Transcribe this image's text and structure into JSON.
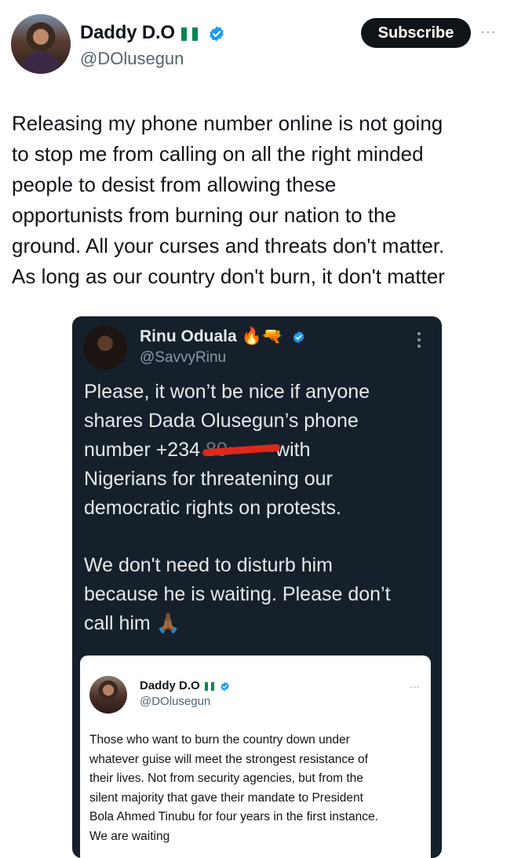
{
  "post": {
    "author_name": "Daddy D.O",
    "author_handle": "@DOlusegun",
    "subscribe_label": "Subscribe",
    "more_label": "···",
    "text_lines": [
      "Releasing my phone number online is not going",
      "to stop me from calling on all the right minded",
      "people to desist from allowing these",
      "opportunists from burning our nation to the",
      "ground. All your curses and threats don't matter.",
      "As long as our country don't burn, it don't matter"
    ]
  },
  "screenshot": {
    "author_name": "Rinu Oduala",
    "author_emoji": "🔥🔫",
    "author_handle": "@SavvyRinu",
    "line1": "Please, it won’t be nice if anyone",
    "line2": "shares Dada Olusegun’s phone",
    "line3_prefix": "number +234",
    "line3_redacted": "80•••••••",
    "line3_suffix": "with",
    "line4": "Nigerians for threatening our",
    "line5": "democratic rights on protests.",
    "line6": "We don't need to disturb him",
    "line7": "because he is waiting. Please don’t",
    "line8": "call him 🙏🏾",
    "quoted": {
      "author_name": "Daddy D.O",
      "author_handle": "@DOlusegun",
      "more_label": "···",
      "lines": [
        "Those who want to burn the country down under",
        "whatever guise will meet the strongest resistance of",
        "their lives. Not from security agencies, but from the",
        "silent majority that gave their mandate to President",
        "Bola Ahmed Tinubu for four years in the first instance.",
        "We are waiting"
      ]
    }
  },
  "colors": {
    "verified": "#1d9bf0",
    "flag_green": "#008751",
    "card_bg": "#15202b",
    "redaction": "#e0271b"
  }
}
